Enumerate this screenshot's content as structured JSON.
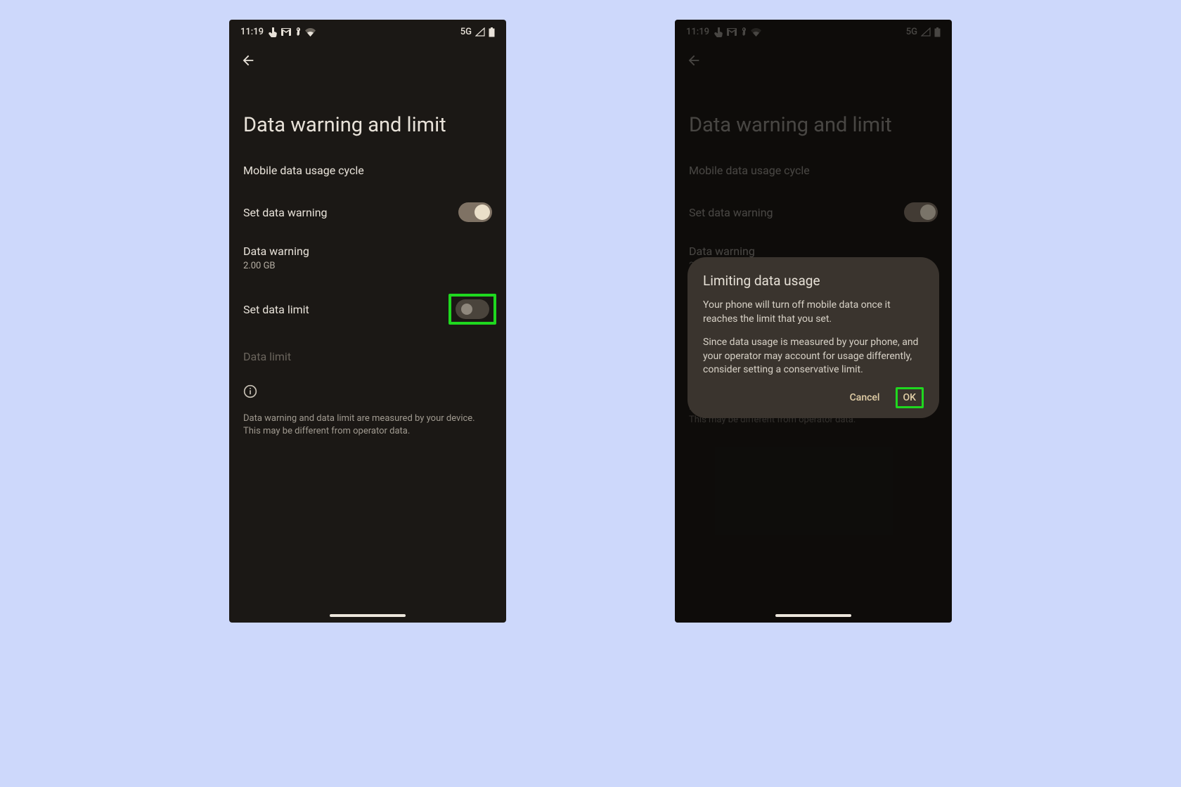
{
  "status": {
    "time": "11:19",
    "network": "5G"
  },
  "screen": {
    "title": "Data warning and limit",
    "items": {
      "usage_cycle": "Mobile data usage cycle",
      "set_data_warning": "Set data warning",
      "data_warning": "Data warning",
      "data_warning_value": "2.00 GB",
      "set_data_limit": "Set data limit",
      "data_limit": "Data limit"
    },
    "footnote": "Data warning and data limit are measured by your device. This may be different from operator data."
  },
  "dialog": {
    "title": "Limiting data usage",
    "para1": "Your phone will turn off mobile data once it reaches the limit that you set.",
    "para2": "Since data usage is measured by your phone, and your operator may account for usage differently, consider setting a conservative limit.",
    "cancel": "Cancel",
    "ok": "OK"
  }
}
